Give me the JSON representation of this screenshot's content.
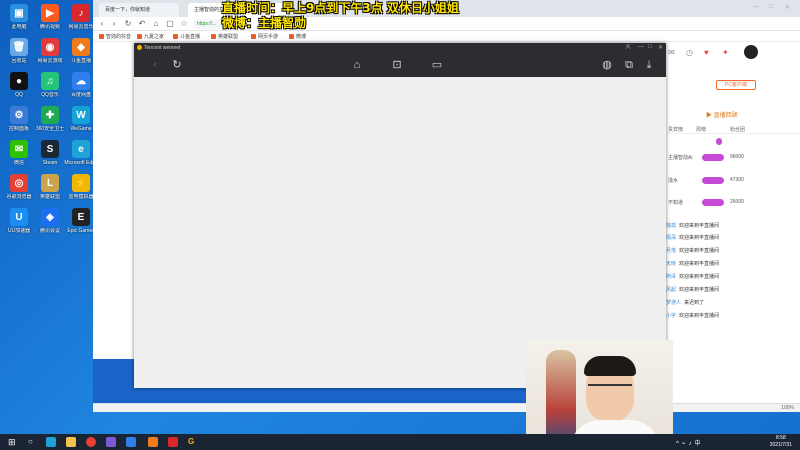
{
  "overlay": {
    "line1": "直播时间：早上9点到下午3点    双休日小姐姐",
    "line2": "微博：主播智勋"
  },
  "desktop": {
    "icons": [
      {
        "label": "此电脑",
        "color": "#2b8fe0",
        "glyph": "▣"
      },
      {
        "label": "腾讯视频",
        "color": "#ff5a1f",
        "glyph": "▶"
      },
      {
        "label": "网易云音乐",
        "color": "#d8282b",
        "glyph": "♪"
      },
      {
        "label": "回收站",
        "color": "#6aa7e6",
        "glyph": "🗑"
      },
      {
        "label": "网易云游戏",
        "color": "#e23b3b",
        "glyph": "◉"
      },
      {
        "label": "斗鱼直播",
        "color": "#f07b1b",
        "glyph": "◆"
      },
      {
        "label": "QQ",
        "color": "#111",
        "glyph": "●"
      },
      {
        "label": "QQ音乐",
        "color": "#24c47a",
        "glyph": "♫"
      },
      {
        "label": "百度网盘",
        "color": "#2f80ed",
        "glyph": "☁"
      },
      {
        "label": "控制面板",
        "color": "#3b7bd8",
        "glyph": "⚙"
      },
      {
        "label": "360安全卫士",
        "color": "#1eaa55",
        "glyph": "✚"
      },
      {
        "label": "WeGame",
        "color": "#16a2d5",
        "glyph": "W"
      },
      {
        "label": "微信",
        "color": "#2dc100",
        "glyph": "✉"
      },
      {
        "label": "Steam",
        "color": "#1b2838",
        "glyph": "S"
      },
      {
        "label": "Microsoft Edge",
        "color": "#1fa2d8",
        "glyph": "e"
      },
      {
        "label": "谷歌浏览器",
        "color": "#e44134",
        "glyph": "◎"
      },
      {
        "label": "英雄联盟",
        "color": "#c9a44b",
        "glyph": "L"
      },
      {
        "label": "雷电模拟器",
        "color": "#f2b705",
        "glyph": "⚡"
      },
      {
        "label": "UU加速器",
        "color": "#1c8ef0",
        "glyph": "U"
      },
      {
        "label": "腾讯会议",
        "color": "#1d6ff2",
        "glyph": "◈"
      },
      {
        "label": "Epic Games",
        "color": "#222",
        "glyph": "E"
      }
    ]
  },
  "browser": {
    "tabs": [
      {
        "label": "百度一下，你就知道"
      },
      {
        "label": "主播智勋的直播间"
      }
    ],
    "url": "https://...",
    "bookmarks": [
      "智勋的抖音",
      "九夏之家",
      "斗鱼直播",
      "英雄联盟",
      "网页手游",
      "微博"
    ],
    "status_text": "100%"
  },
  "tencent": {
    "title": "Tencent wemeet",
    "nav_icons": [
      "back-icon",
      "refresh-icon",
      "home-icon",
      "inbox-icon",
      "video-icon",
      "globe-icon",
      "share-icon",
      "download-icon"
    ]
  },
  "stream": {
    "follow_button": "PC客户端",
    "replay_label": "直播回顾",
    "tabs": [
      "贵宾榜",
      "周榜",
      "粉丝团"
    ],
    "rank_rows": [
      {
        "name": "主播智勋Ai",
        "value": "96000"
      },
      {
        "name": "浅水",
        "value": "47300"
      },
      {
        "name": "不知道",
        "value": "26000"
      }
    ],
    "chat": [
      {
        "user": "独孤",
        "text": "欢迎来到丰直播间"
      },
      {
        "user": "情深",
        "text": "欢迎来到丰直播间"
      },
      {
        "user": "月落",
        "text": "欢迎来到丰直播间"
      },
      {
        "user": "天晓",
        "text": "欢迎来到丰直播间"
      },
      {
        "user": "阿泽",
        "text": "欢迎来到丰直播间"
      },
      {
        "user": "风起",
        "text": "欢迎来到丰直播间"
      },
      {
        "user": "梦游人",
        "text": "来迟到了"
      },
      {
        "user": "小宇",
        "text": "欢迎来到丰直播间"
      }
    ]
  },
  "taskbar": {
    "time": "8:58",
    "date": "2021/7/31"
  }
}
